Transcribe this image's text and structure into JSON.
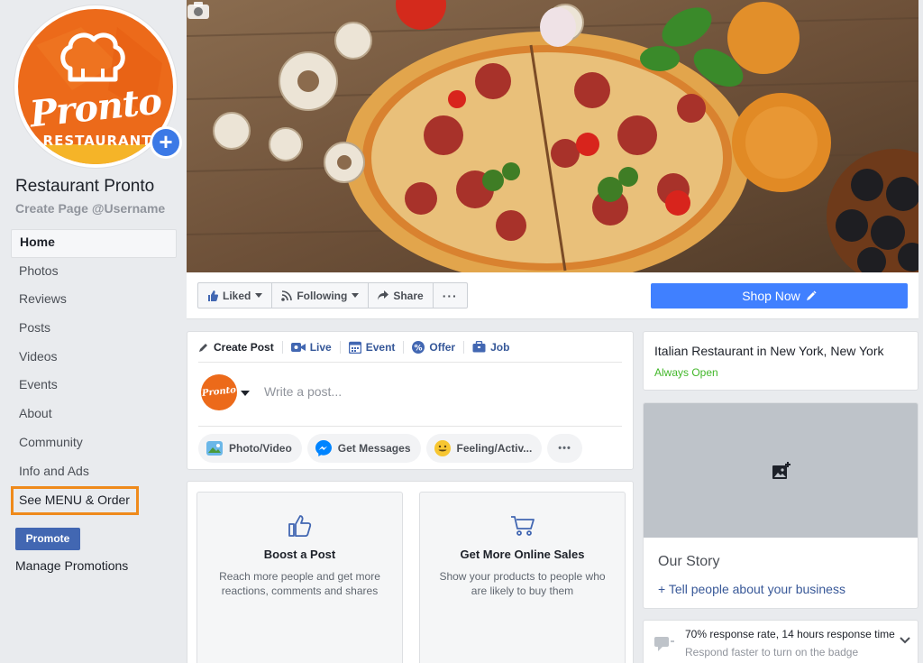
{
  "page": {
    "name": "Restaurant Pronto",
    "username_prompt": "Create Page @Username",
    "logo": {
      "script": "Pronto",
      "subtitle": "RESTAURANT",
      "add_icon": "plus-icon"
    }
  },
  "sidebar": {
    "items": [
      {
        "label": "Home",
        "active": true
      },
      {
        "label": "Photos"
      },
      {
        "label": "Reviews"
      },
      {
        "label": "Posts"
      },
      {
        "label": "Videos"
      },
      {
        "label": "Events"
      },
      {
        "label": "About"
      },
      {
        "label": "Community"
      },
      {
        "label": "Info and Ads"
      },
      {
        "label": "See MENU & Order",
        "highlighted": true
      }
    ],
    "promote_label": "Promote",
    "manage_promotions_label": "Manage Promotions"
  },
  "action_bar": {
    "liked_label": "Liked",
    "following_label": "Following",
    "share_label": "Share",
    "more_label": "···",
    "shop_now_label": "Shop Now"
  },
  "composer": {
    "tabs": [
      {
        "label": "Create Post",
        "icon": "pencil-icon"
      },
      {
        "label": "Live",
        "icon": "video-icon"
      },
      {
        "label": "Event",
        "icon": "calendar-icon"
      },
      {
        "label": "Offer",
        "icon": "offer-icon"
      },
      {
        "label": "Job",
        "icon": "briefcase-icon"
      }
    ],
    "avatar_text": "Pronto",
    "placeholder": "Write a post...",
    "actions": [
      {
        "label": "Photo/Video",
        "icon": "photo-icon"
      },
      {
        "label": "Get Messages",
        "icon": "messenger-icon"
      },
      {
        "label": "Feeling/Activ...",
        "icon": "smiley-icon"
      },
      {
        "label": "•••",
        "icon": "more-icon"
      }
    ]
  },
  "promo_cards": [
    {
      "title": "Boost a Post",
      "description": "Reach more people and get more reactions, comments and shares",
      "icon": "thumbs-up-icon"
    },
    {
      "title": "Get More Online Sales",
      "description": "Show your products to people who are likely to buy them",
      "icon": "cart-icon"
    }
  ],
  "about": {
    "category": "Italian Restaurant in New York, New York",
    "hours": "Always Open"
  },
  "story": {
    "title": "Our Story",
    "link": "+ Tell people about your business"
  },
  "responsiveness": {
    "main": "70% response rate, 14 hours response time",
    "sub": "Respond faster to turn on the badge"
  },
  "colors": {
    "brand_orange": "#ec6a1a",
    "facebook_blue": "#4267b2",
    "shop_button": "#4080ff",
    "open_green": "#42b72a",
    "highlight_border": "#ef8a1b"
  }
}
